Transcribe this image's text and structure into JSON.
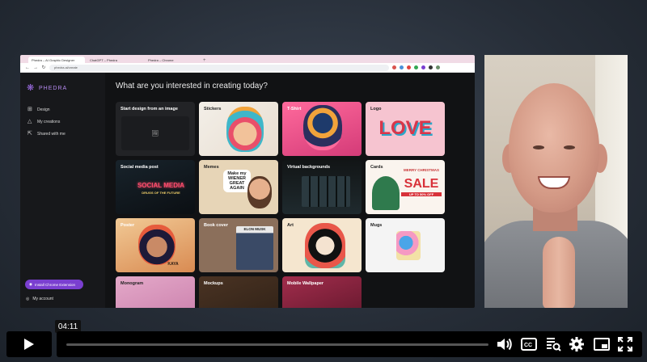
{
  "browser": {
    "tabs": [
      {
        "label": "Phedra – AI Graphic Designer",
        "active": true
      },
      {
        "label": "ChatGPT – Phedra",
        "active": false
      },
      {
        "label": "Phedra – Chrome",
        "active": false
      }
    ],
    "url": "phedra.ai/create"
  },
  "sidebar": {
    "logo_text": "PHEDRA",
    "items": [
      {
        "label": "Design",
        "icon": "grid-icon"
      },
      {
        "label": "My creations",
        "icon": "triangle-icon"
      },
      {
        "label": "Shared with me",
        "icon": "share-icon"
      }
    ],
    "chrome_button": "Install Chrome Extension",
    "account": "My account"
  },
  "main": {
    "headline": "What are you interested in creating today?",
    "cards": [
      {
        "label": "Start design from an image"
      },
      {
        "label": "Stickers"
      },
      {
        "label": "T-Shirt"
      },
      {
        "label": "Logo",
        "art_text": "LOVE"
      },
      {
        "label": "Social media post",
        "art_text": "SOCIAL MEDIA",
        "art_sub": "DRUGS OF THE FUTURE"
      },
      {
        "label": "Memes",
        "art_text": "Make my WIENER GREAT AGAIN"
      },
      {
        "label": "Virtual backgrounds"
      },
      {
        "label": "Cards",
        "art_text": "SALE",
        "art_top": "MERRY CHRISTMAS",
        "art_sub": "UP TO 50% OFF"
      },
      {
        "label": "Poster",
        "art_text": "KAYA"
      },
      {
        "label": "Book cover",
        "art_text": "ELON MUSK"
      },
      {
        "label": "Art"
      },
      {
        "label": "Mugs"
      },
      {
        "label": "Monogram"
      },
      {
        "label": "Mockups"
      },
      {
        "label": "Mobile Wallpaper"
      }
    ]
  },
  "player": {
    "time_tooltip": "04:11",
    "progress": 0
  },
  "colors": {
    "accent": "#7a3fd0",
    "logo": "#b68af0"
  }
}
